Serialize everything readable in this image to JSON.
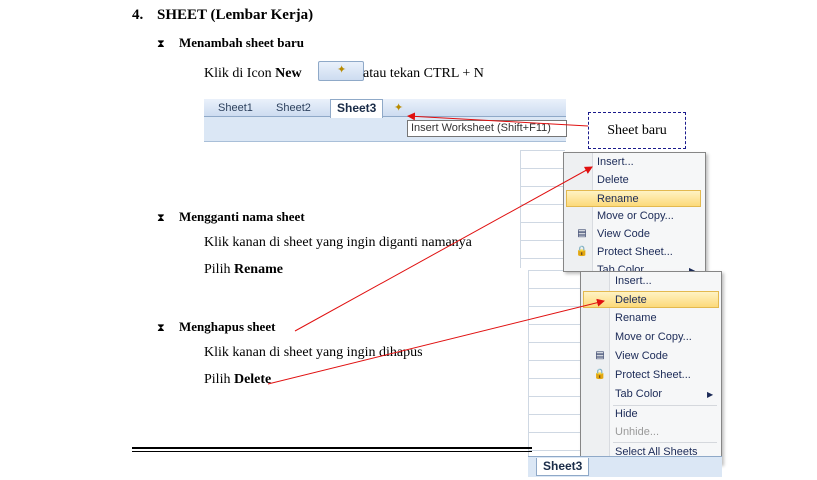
{
  "heading": {
    "number": "4.",
    "title": "SHEET (Lembar Kerja)"
  },
  "sections": {
    "add": {
      "bullet_icon": "hourglass-icon",
      "title": "Menambah sheet baru",
      "line_prefix": "Klik di Icon ",
      "line_bold": "New",
      "line_suffix": "atau tekan CTRL + N"
    },
    "rename": {
      "bullet_icon": "hourglass-icon",
      "title": "Mengganti nama sheet",
      "line1": "Klik kanan di sheet yang ingin diganti namanya",
      "line2_prefix": "Pilih ",
      "line2_bold": "Rename"
    },
    "delete": {
      "bullet_icon": "hourglass-icon",
      "title": "Menghapus sheet",
      "line1": "Klik kanan di sheet yang ingin dihapus",
      "line2_prefix": "Pilih ",
      "line2_bold": "Delete"
    }
  },
  "sheet_tabs": [
    "Sheet1",
    "Sheet2",
    "Sheet3"
  ],
  "insert_tooltip": "Insert Worksheet (Shift+F11)",
  "callout": "Sheet baru",
  "menu1": {
    "items": [
      "Insert...",
      "Delete",
      "Rename",
      "Move or Copy...",
      "View Code",
      "Protect Sheet...",
      "Tab Color"
    ],
    "highlighted": "Rename"
  },
  "menu2": {
    "items": [
      "Insert...",
      "Delete",
      "Rename",
      "Move or Copy...",
      "View Code",
      "Protect Sheet...",
      "Tab Color",
      "Hide",
      "Unhide...",
      "Select All Sheets"
    ],
    "highlighted": "Delete",
    "disabled": "Unhide..."
  },
  "bottom_tab": "Sheet3",
  "colors": {
    "arrow": "#e01010",
    "menu_highlight": "#fcd97a",
    "tab_strip": "#dbe7f5"
  }
}
